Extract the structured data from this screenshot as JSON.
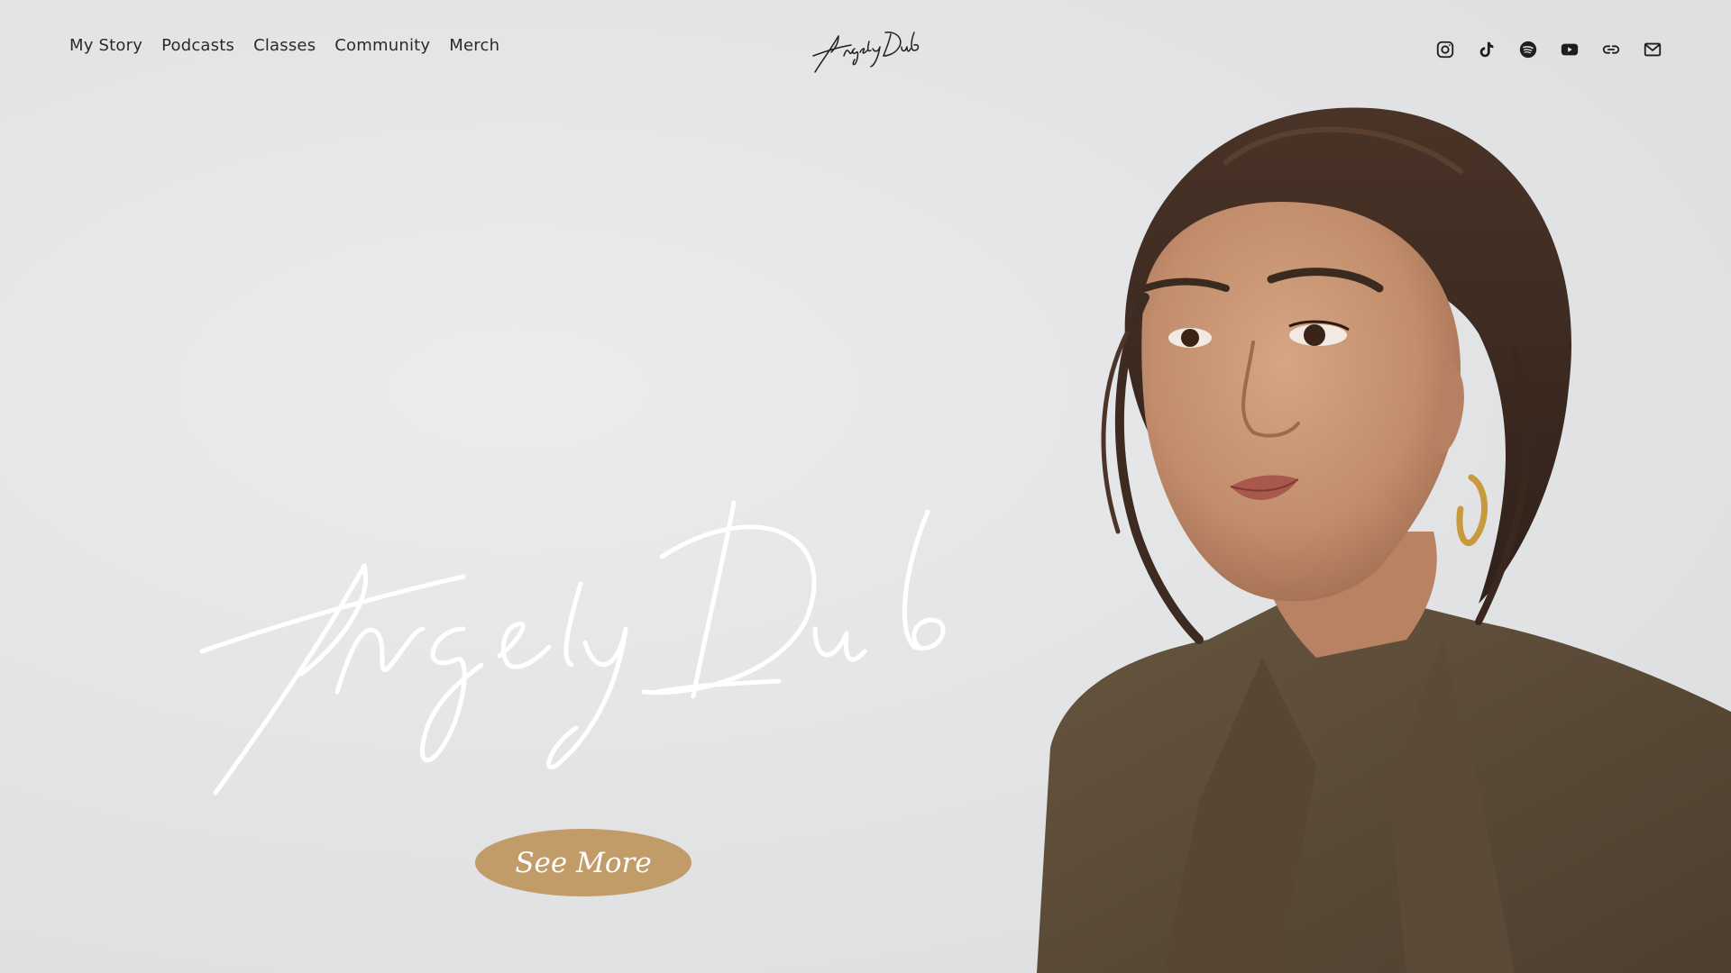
{
  "nav": {
    "items": [
      {
        "label": "My Story"
      },
      {
        "label": "Podcasts"
      },
      {
        "label": "Classes"
      },
      {
        "label": "Community"
      },
      {
        "label": "Merch"
      }
    ]
  },
  "brand": {
    "logo_text": "AngelyDub",
    "hero_signature_text": "AngelyDub"
  },
  "socials": [
    {
      "icon": "instagram-icon"
    },
    {
      "icon": "tiktok-icon"
    },
    {
      "icon": "spotify-icon"
    },
    {
      "icon": "youtube-icon"
    },
    {
      "icon": "link-icon"
    },
    {
      "icon": "mail-icon"
    }
  ],
  "hero": {
    "cta_label": "See More"
  },
  "colors": {
    "background": "#e4e5e7",
    "text": "#2a2a2a",
    "cta_background": "#c19c68",
    "cta_text": "#ffffff",
    "signature": "#ffffff",
    "blazer": "#5a4a3a"
  }
}
